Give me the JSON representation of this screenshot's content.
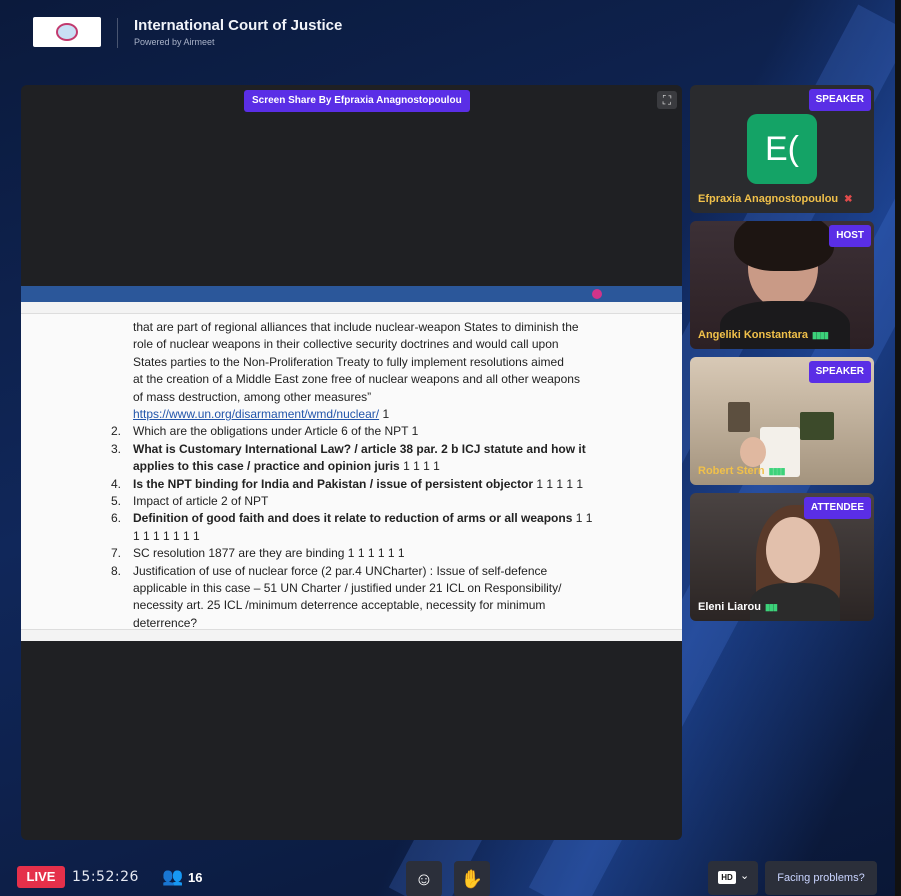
{
  "header": {
    "event_title": "International Court of Justice",
    "powered_by": "Powered by Airmeet"
  },
  "stage": {
    "share_label": "Screen Share By Efpraxia Anagnostopoulou",
    "expand_icon": "expand-icon",
    "document": {
      "lines": [
        {
          "num": "",
          "text": "that are part of regional alliances that include nuclear-weapon States to diminish the",
          "bold": false
        },
        {
          "num": "",
          "text": "role of nuclear weapons in their collective security doctrines and would call upon",
          "bold": false
        },
        {
          "num": "",
          "text": "States parties to the Non-Proliferation Treaty to fully implement resolutions aimed",
          "bold": false
        },
        {
          "num": "",
          "text": "at the creation of a Middle East zone free of nuclear weapons and all other weapons",
          "bold": false
        },
        {
          "num": "",
          "text": "of mass destruction, among other measures”",
          "bold": false
        },
        {
          "num": "",
          "text": "https://www.un.org/disarmament/wmd/nuclear/",
          "bold": false,
          "link": true,
          "suffix": "    1"
        },
        {
          "num": "2.",
          "text": "Which are the obligations under Article 6 of the NPT  1",
          "bold": false
        },
        {
          "num": "3.",
          "text": "What is Customary International Law? / article 38 par. 2 b ICJ statute and how it",
          "bold": true
        },
        {
          "num": "",
          "text": "applies to this case / practice and opinion juris",
          "bold": true,
          "suffix": "     1 1 1 1"
        },
        {
          "num": "4.",
          "text": "Is the NPT binding for India and Pakistan / issue of persistent objector",
          "bold": true,
          "suffix": " 1 1 1 1 1"
        },
        {
          "num": "5.",
          "text": "Impact of article 2 of NPT",
          "bold": false
        },
        {
          "num": "6.",
          "text": "Definition of good faith and does it relate to reduction of arms or all weapons",
          "bold": true,
          "suffix": "  1 1"
        },
        {
          "num": "",
          "text": "1 1 1  1  1  1 1",
          "bold": false
        },
        {
          "num": "7.",
          "text": "SC resolution 1877 are they are binding  1 1 1 1 1 1",
          "bold": false
        },
        {
          "num": "8.",
          "text": "Justification of use of nuclear force (2 par.4 UNCharter)  : Issue of self-defence",
          "bold": false
        },
        {
          "num": "",
          "text": "applicable in this case – 51 UN Charter / justified under 21 ICL on Responsibility/",
          "bold": false
        },
        {
          "num": "",
          "text": "necessity art. 25 ICL /minimum deterrence acceptable, necessity for minimum",
          "bold": false
        },
        {
          "num": "",
          "text": "deterrence?",
          "bold": false
        }
      ]
    }
  },
  "participants": [
    {
      "name": "Efpraxia Anagnostopoulou",
      "role": "SPEAKER",
      "initials": "E(",
      "mic": "muted"
    },
    {
      "name": "Angeliki Konstantara",
      "role": "HOST",
      "mic": "active"
    },
    {
      "name": "Robert Stern",
      "role": "SPEAKER",
      "mic": "active"
    },
    {
      "name": "Eleni Liarou",
      "role": "ATTENDEE",
      "mic": "active"
    }
  ],
  "bottom": {
    "live_label": "LIVE",
    "clock": "15:52:26",
    "attendee_count": "16",
    "hd_label": "HD",
    "problems_label": "Facing problems?"
  },
  "colors": {
    "badge": "#5a2ee6",
    "live": "#e5304a",
    "name": "#f0c04a",
    "avatar": "#14a366"
  }
}
